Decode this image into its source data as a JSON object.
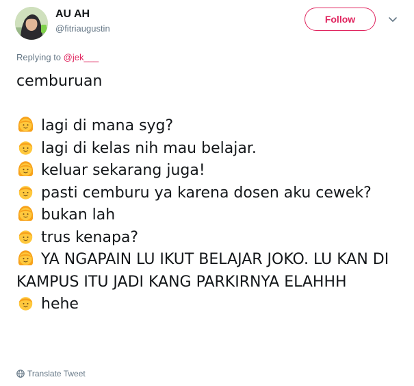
{
  "user": {
    "name": "AU AH",
    "handle": "@fitriaugustin"
  },
  "actions": {
    "follow_label": "Follow"
  },
  "reply": {
    "prefix": "Replying to",
    "mention": "@jek___"
  },
  "tweet": {
    "title": "cemburuan",
    "lines": [
      {
        "speaker": "girl",
        "text": "lagi di mana syg?"
      },
      {
        "speaker": "boy",
        "text": "lagi di kelas nih mau belajar."
      },
      {
        "speaker": "girl",
        "text": "keluar sekarang juga!"
      },
      {
        "speaker": "boy",
        "text": "pasti cemburu ya karena dosen aku cewek?"
      },
      {
        "speaker": "girl",
        "text": "bukan lah"
      },
      {
        "speaker": "boy",
        "text": "trus kenapa?"
      },
      {
        "speaker": "girl",
        "text": "YA NGAPAIN LU IKUT BELAJAR JOKO. LU KAN DI KAMPUS ITU JADI KANG PARKIRNYA ELAHHH"
      },
      {
        "speaker": "boy",
        "text": "hehe"
      }
    ]
  },
  "footer": {
    "translate_label": "Translate Tweet"
  },
  "icons": {
    "girl": "girl-emoji-icon",
    "boy": "boy-emoji-icon",
    "globe": "globe-icon",
    "caret": "chevron-down-icon"
  },
  "colors": {
    "accent": "#e0245e",
    "muted": "#657786",
    "text": "#14171a",
    "emoji_skin": "#ffc83d",
    "emoji_hair": "#f7a21b"
  }
}
